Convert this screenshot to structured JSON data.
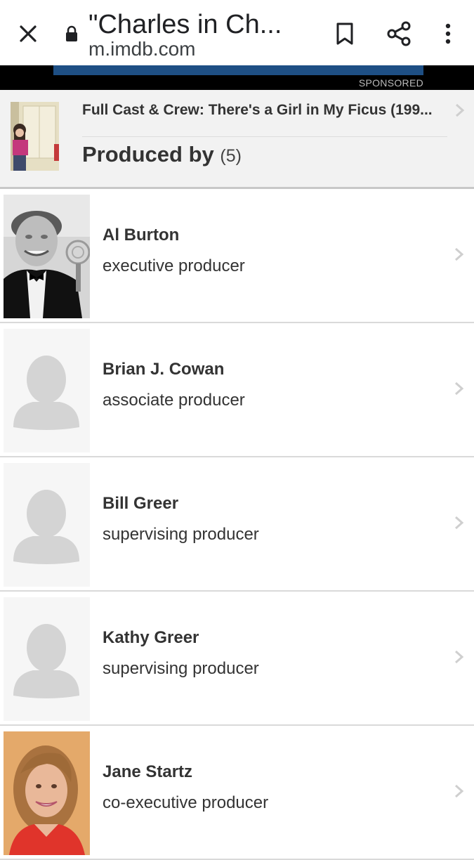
{
  "browser": {
    "title": "\"Charles in Ch...",
    "url": "m.imdb.com",
    "icons": [
      "close-icon",
      "lock-icon",
      "bookmark-icon",
      "share-icon",
      "overflow-menu-icon"
    ]
  },
  "ad": {
    "label": "SPONSORED"
  },
  "header": {
    "link_text": "Full Cast & Crew: There's a Girl in My Ficus (199...",
    "section_title": "Produced by",
    "section_count": "(5)"
  },
  "producers": [
    {
      "name": "Al Burton",
      "role": "executive producer",
      "photo": "photo"
    },
    {
      "name": "Brian J. Cowan",
      "role": "associate producer",
      "photo": "placeholder"
    },
    {
      "name": "Bill Greer",
      "role": "supervising producer",
      "photo": "placeholder"
    },
    {
      "name": "Kathy Greer",
      "role": "supervising producer",
      "photo": "placeholder"
    },
    {
      "name": "Jane Startz",
      "role": "co-executive producer",
      "photo": "photo"
    }
  ],
  "colors": {
    "ad_blue": "#1e4f84",
    "header_bg": "#f2f2f2",
    "text": "#333333",
    "placeholder": "#d4d4d4"
  }
}
